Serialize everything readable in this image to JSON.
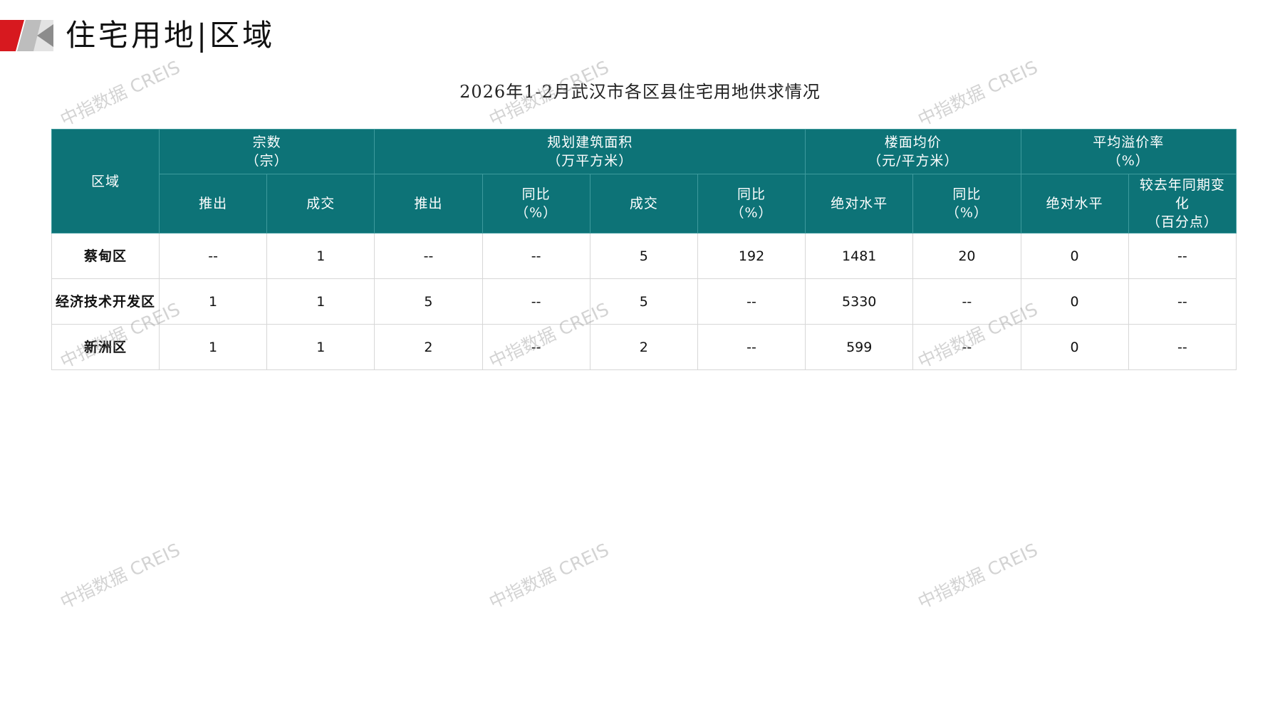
{
  "header": {
    "title": "住宅用地|区域"
  },
  "table": {
    "title": "2026年1-2月武汉市各区县住宅用地供求情况",
    "region_header": "区域",
    "groups": [
      {
        "label": "宗数",
        "unit": "（宗）"
      },
      {
        "label": "规划建筑面积",
        "unit": "（万平方米）"
      },
      {
        "label": "楼面均价",
        "unit": "（元/平方米）"
      },
      {
        "label": "平均溢价率",
        "unit": "（%）"
      }
    ],
    "subheaders": [
      {
        "label": "推出",
        "unit": ""
      },
      {
        "label": "成交",
        "unit": ""
      },
      {
        "label": "推出",
        "unit": ""
      },
      {
        "label": "同比",
        "unit": "（%）"
      },
      {
        "label": "成交",
        "unit": ""
      },
      {
        "label": "同比",
        "unit": "（%）"
      },
      {
        "label": "绝对水平",
        "unit": ""
      },
      {
        "label": "同比",
        "unit": "（%）"
      },
      {
        "label": "绝对水平",
        "unit": ""
      },
      {
        "label": "较去年同期变化",
        "unit": "（百分点）"
      }
    ],
    "rows": [
      {
        "region": "蔡甸区",
        "cells": [
          "--",
          "1",
          "--",
          "--",
          "5",
          "192",
          "1481",
          "20",
          "0",
          "--"
        ]
      },
      {
        "region": "经济技术开发区",
        "cells": [
          "1",
          "1",
          "5",
          "--",
          "5",
          "--",
          "5330",
          "--",
          "0",
          "--"
        ]
      },
      {
        "region": "新洲区",
        "cells": [
          "1",
          "1",
          "2",
          "--",
          "2",
          "--",
          "599",
          "--",
          "0",
          "--"
        ]
      }
    ]
  },
  "watermark": {
    "text": "中指数据 CREIS"
  },
  "colors": {
    "header_bg": "#0d7377",
    "accent_red": "#d7191f",
    "accent_gray": "#9a9a9a"
  }
}
